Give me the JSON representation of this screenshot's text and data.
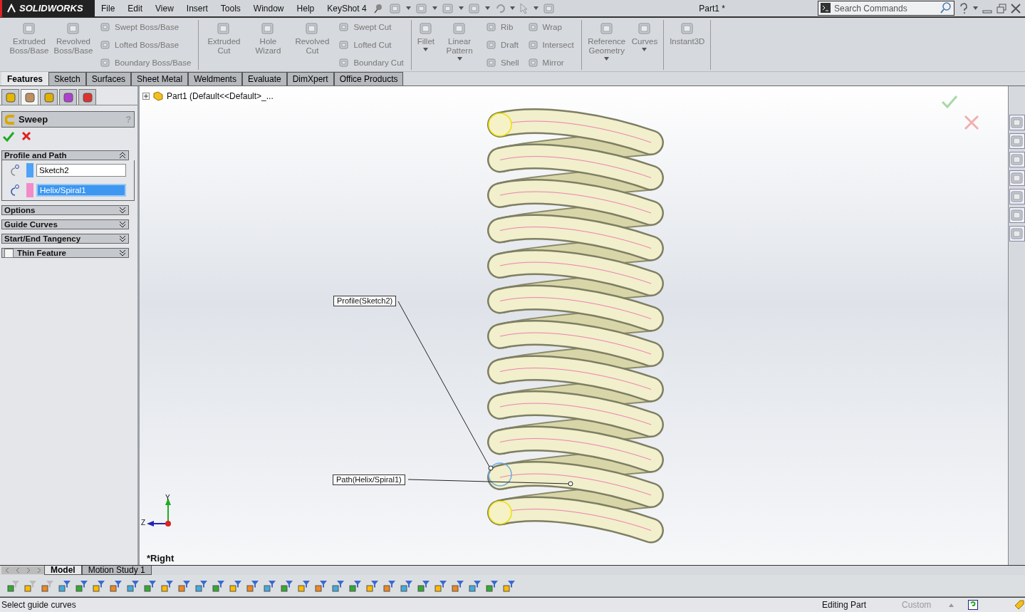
{
  "title_bar": {
    "logo": "SOLIDWORKS",
    "menus": [
      "File",
      "Edit",
      "View",
      "Insert",
      "Tools",
      "Window",
      "Help",
      "KeyShot 4"
    ],
    "document_title": "Part1 *",
    "search": {
      "placeholder": "Search Commands"
    }
  },
  "ribbon": {
    "groups": [
      {
        "large": [
          {
            "label": "Extruded Boss/Base",
            "dropdown": false
          },
          {
            "label": "Revolved Boss/Base",
            "dropdown": false
          }
        ],
        "small_columns": [
          [
            "Swept Boss/Base",
            "Lofted Boss/Base",
            "Boundary Boss/Base"
          ]
        ]
      },
      {
        "large": [
          {
            "label": "Extruded Cut",
            "dropdown": false
          },
          {
            "label": "Hole Wizard",
            "dropdown": false
          },
          {
            "label": "Revolved Cut",
            "dropdown": false
          }
        ],
        "small_columns": [
          [
            "Swept Cut",
            "Lofted Cut",
            "Boundary Cut"
          ]
        ]
      },
      {
        "large": [
          {
            "label": "Fillet",
            "dropdown": true
          },
          {
            "label": "Linear Pattern",
            "dropdown": true
          }
        ],
        "small_columns": [
          [
            "Rib",
            "Draft",
            "Shell"
          ],
          [
            "Wrap",
            "Intersect",
            "Mirror"
          ]
        ]
      },
      {
        "large": [
          {
            "label": "Reference Geometry",
            "dropdown": true
          },
          {
            "label": "Curves",
            "dropdown": true
          }
        ]
      },
      {
        "large": [
          {
            "label": "Instant3D",
            "dropdown": false
          }
        ]
      }
    ]
  },
  "command_tabs": [
    {
      "label": "Features",
      "selected": true
    },
    {
      "label": "Sketch",
      "selected": false
    },
    {
      "label": "Surfaces",
      "selected": false
    },
    {
      "label": "Sheet Metal",
      "selected": false
    },
    {
      "label": "Weldments",
      "selected": false
    },
    {
      "label": "Evaluate",
      "selected": false
    },
    {
      "label": "DimXpert",
      "selected": false
    },
    {
      "label": "Office Products",
      "selected": false
    }
  ],
  "panel_tabs": [
    {
      "selected": false
    },
    {
      "selected": true
    },
    {
      "selected": false
    },
    {
      "selected": false
    },
    {
      "selected": false
    }
  ],
  "property_manager": {
    "title": "Sweep",
    "help": "?",
    "sections": [
      {
        "title": "Profile and Path",
        "expanded": true,
        "fields": [
          {
            "value": "Sketch2",
            "color": "#4ea2f7",
            "selected": false
          },
          {
            "value": "Helix/Spiral1",
            "color": "#f28cc8",
            "selected": true
          }
        ]
      },
      {
        "title": "Options",
        "expanded": false
      },
      {
        "title": "Guide Curves",
        "expanded": false
      },
      {
        "title": "Start/End Tangency",
        "expanded": false
      },
      {
        "title": "Thin Feature",
        "expanded": false,
        "checked": false
      }
    ]
  },
  "viewport": {
    "tree_item": "Part1  (Default<<Default>_...",
    "callouts": [
      "Profile(Sketch2)",
      "Path(Helix/Spiral1)"
    ],
    "triad": {
      "y_label": "Y",
      "z_label": "Z"
    },
    "view_name": "*Right"
  },
  "bottom_tabs": [
    {
      "label": "Model",
      "selected": true
    },
    {
      "label": "Motion Study 1",
      "selected": false
    }
  ],
  "status_bar": {
    "message": "Select guide curves",
    "mode": "Editing Part",
    "units": "Custom"
  }
}
